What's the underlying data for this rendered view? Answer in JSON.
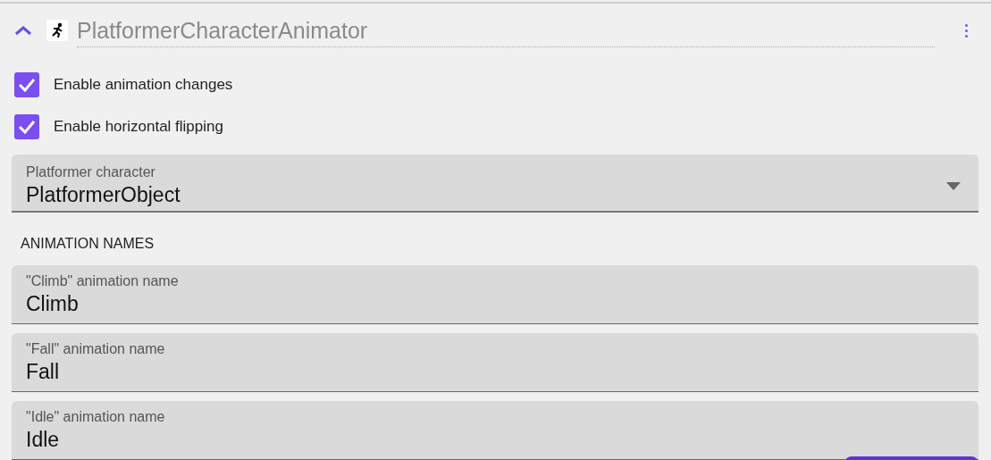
{
  "header": {
    "expanded": true,
    "title": "PlatformerCharacterAnimator"
  },
  "checkboxes": [
    {
      "label": "Enable animation changes",
      "checked": true
    },
    {
      "label": "Enable horizontal flipping",
      "checked": true
    }
  ],
  "select": {
    "label": "Platformer character",
    "value": "PlatformerObject"
  },
  "section_title": "ANIMATION NAMES",
  "fields": [
    {
      "label": "\"Climb\" animation name",
      "value": "Climb"
    },
    {
      "label": "\"Fall\" animation name",
      "value": "Fall"
    },
    {
      "label": "\"Idle\" animation name",
      "value": "Idle"
    }
  ]
}
